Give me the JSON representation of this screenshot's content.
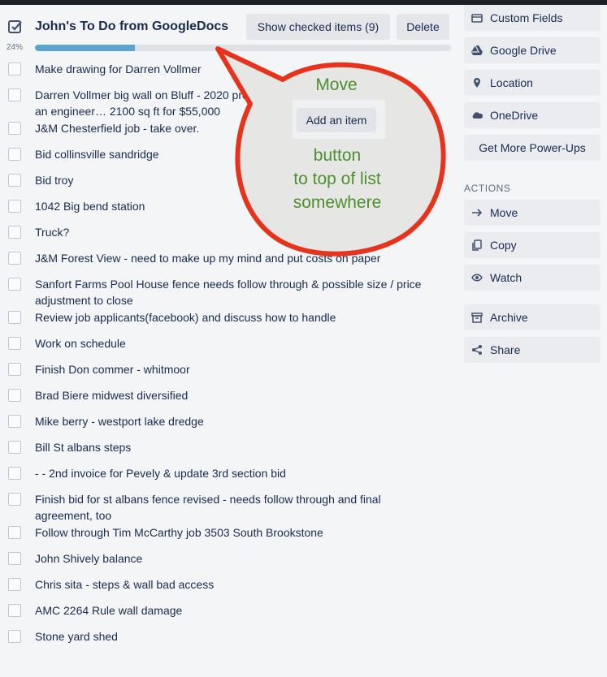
{
  "checklist": {
    "title": "John's To Do from GoogleDocs",
    "show_checked_label": "Show checked items (9)",
    "delete_label": "Delete",
    "progress_label": "24%",
    "progress": 24,
    "items": [
      "Make drawing for Darren Vollmer",
      "Darren Vollmer big wall on Bluff - 2020 project planning now - He said he has an engineer… 2100 sq ft for $55,000",
      "J&M Chesterfield job - take over.",
      "Bid collinsville sandridge",
      "Bid troy",
      "1042 Big bend station",
      "Truck?",
      "J&M Forest View - need to make up my mind and put costs on paper",
      "Sanfort Farms Pool House fence needs follow through & possible size / price adjustment to close",
      "Review job applicants(facebook) and discuss how to handle",
      "Work on schedule",
      "Finish Don commer - whitmoor",
      "Brad Biere midwest diversified",
      "Mike berry - westport lake dredge",
      "Bill St albans steps",
      "- - 2nd invoice for Pevely & update 3rd section bid",
      "Finish bid for st albans fence revised - needs follow through and final agreement, too",
      "Follow through Tim McCarthy job 3503 South Brookstone",
      "John Shively balance",
      "Chris sita - steps & wall bad access",
      "AMC 2264 Rule wall damage",
      "Stone yard shed"
    ]
  },
  "sidebar": {
    "powerups": [
      {
        "label": "Custom Fields",
        "icon": "custom-fields-icon"
      },
      {
        "label": "Google Drive",
        "icon": "google-drive-icon"
      },
      {
        "label": "Location",
        "icon": "location-pin-icon"
      },
      {
        "label": "OneDrive",
        "icon": "onedrive-cloud-icon"
      }
    ],
    "get_more_label": "Get More Power-Ups",
    "actions_heading": "ACTIONS",
    "actions": [
      {
        "label": "Move",
        "icon": "arrow-right-icon"
      },
      {
        "label": "Copy",
        "icon": "copy-icon"
      },
      {
        "label": "Watch",
        "icon": "eye-icon"
      },
      {
        "label": "Archive",
        "icon": "archive-icon"
      },
      {
        "label": "Share",
        "icon": "share-icon"
      }
    ]
  },
  "annotation": {
    "line1": "Move",
    "button_label": "Add an item",
    "line2": "button",
    "line3": "to top of list",
    "line4": "somewhere"
  },
  "colors": {
    "progress_fill": "#5ba4cf",
    "annotation_border": "#e8331c",
    "annotation_text": "#4d8f2f"
  }
}
